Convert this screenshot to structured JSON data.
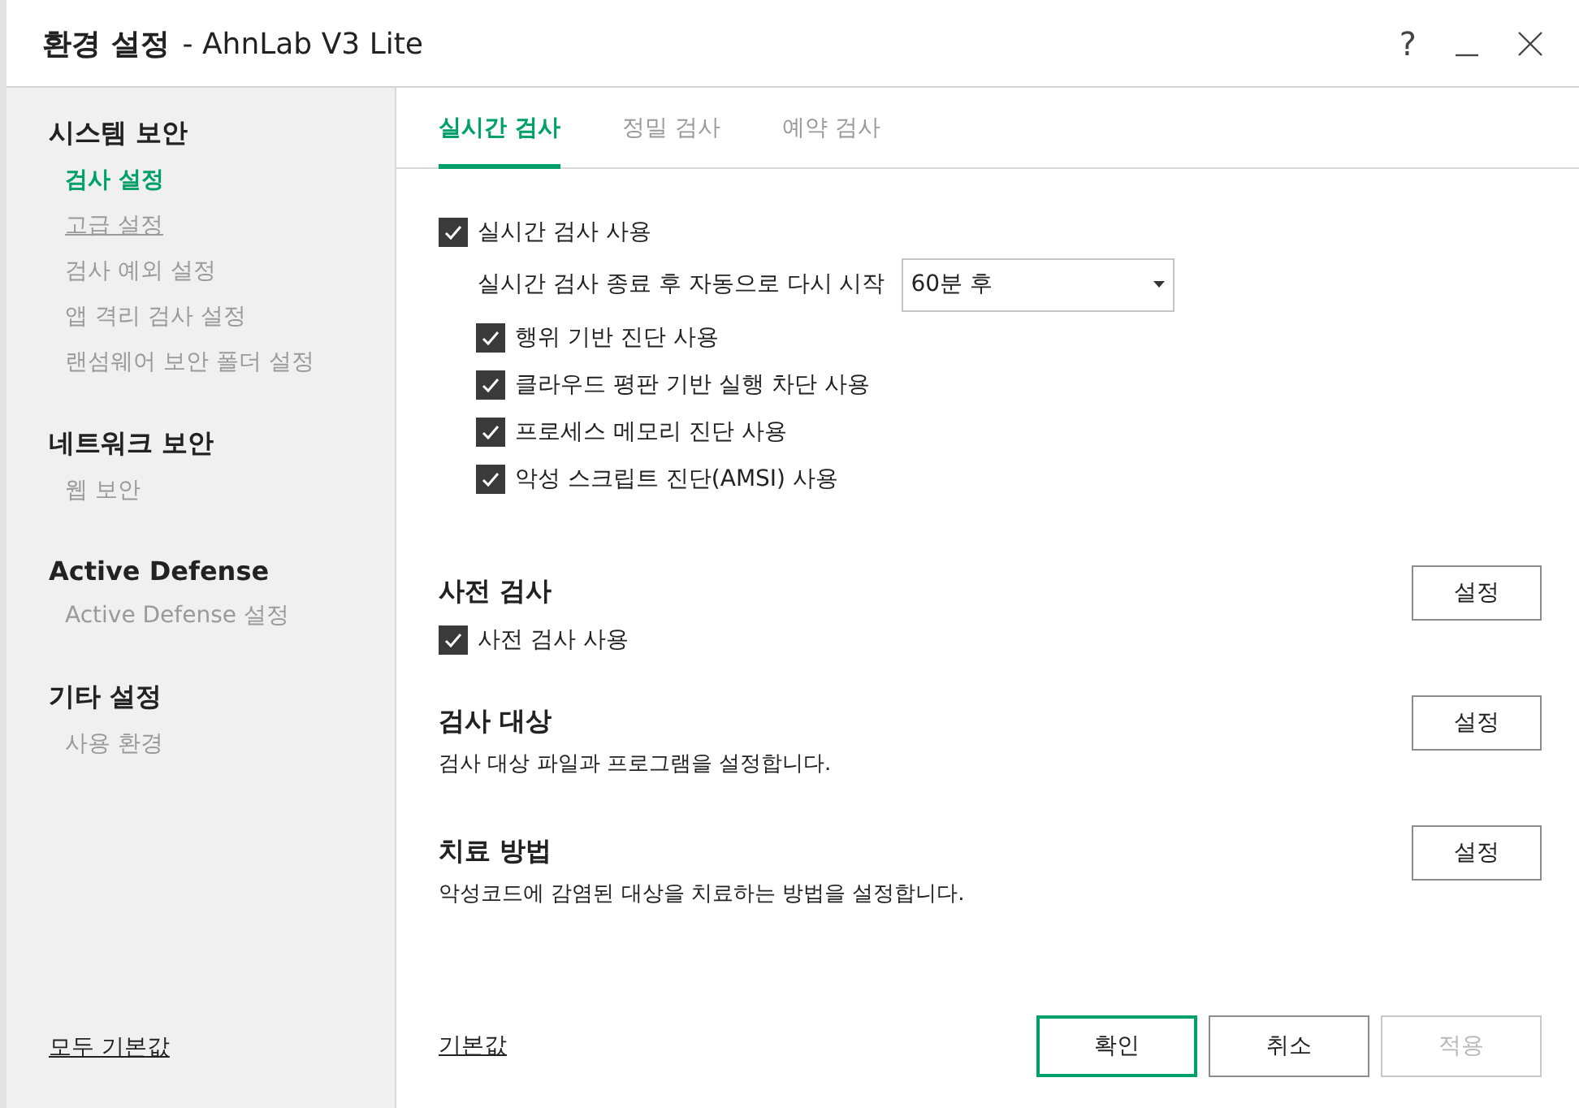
{
  "window": {
    "title": "환경 설정",
    "app": "- AhnLab V3 Lite",
    "help": "?"
  },
  "sidebar": {
    "groups": [
      {
        "title": "시스템 보안",
        "items": [
          {
            "label": "검사 설정",
            "selected": true,
            "hovered": false
          },
          {
            "label": "고급 설정",
            "selected": false,
            "hovered": true
          },
          {
            "label": "검사 예외 설정",
            "selected": false,
            "hovered": false
          },
          {
            "label": "앱 격리 검사 설정",
            "selected": false,
            "hovered": false
          },
          {
            "label": "랜섬웨어 보안 폴더 설정",
            "selected": false,
            "hovered": false
          }
        ]
      },
      {
        "title": "네트워크 보안",
        "items": [
          {
            "label": "웹 보안",
            "selected": false,
            "hovered": false
          }
        ]
      },
      {
        "title": "Active Defense",
        "items": [
          {
            "label": "Active Defense 설정",
            "selected": false,
            "hovered": false
          }
        ]
      },
      {
        "title": "기타 설정",
        "items": [
          {
            "label": "사용 환경",
            "selected": false,
            "hovered": false
          }
        ]
      }
    ],
    "reset_all": "모두 기본값"
  },
  "tabs": [
    {
      "label": "실시간 검사",
      "selected": true
    },
    {
      "label": "정밀 검사",
      "selected": false
    },
    {
      "label": "예약 검사",
      "selected": false
    }
  ],
  "realtime": {
    "enable": {
      "label": "실시간 검사 사용",
      "checked": true
    },
    "restart": {
      "label": "실시간 검사 종료 후 자동으로 다시 시작",
      "value": "60분 후"
    },
    "options": [
      {
        "label": "행위 기반 진단 사용",
        "checked": true
      },
      {
        "label": "클라우드 평판 기반 실행 차단 사용",
        "checked": true
      },
      {
        "label": "프로세스 메모리 진단 사용",
        "checked": true
      },
      {
        "label": "악성 스크립트 진단(AMSI) 사용",
        "checked": true
      }
    ]
  },
  "sections": [
    {
      "kind": "checkbox",
      "title": "사전 검사",
      "checkbox": {
        "label": "사전 검사 사용",
        "checked": true
      },
      "button": "설정"
    },
    {
      "kind": "description",
      "title": "검사 대상",
      "description": "검사 대상 파일과 프로그램을 설정합니다.",
      "button": "설정"
    },
    {
      "kind": "description",
      "title": "치료 방법",
      "description": "악성코드에 감염된 대상을 치료하는 방법을 설정합니다.",
      "button": "설정"
    }
  ],
  "footer": {
    "reset": "기본값",
    "buttons": [
      {
        "label": "확인",
        "kind": "primary",
        "disabled": false
      },
      {
        "label": "취소",
        "kind": "normal",
        "disabled": false
      },
      {
        "label": "적용",
        "kind": "normal",
        "disabled": true
      }
    ]
  }
}
